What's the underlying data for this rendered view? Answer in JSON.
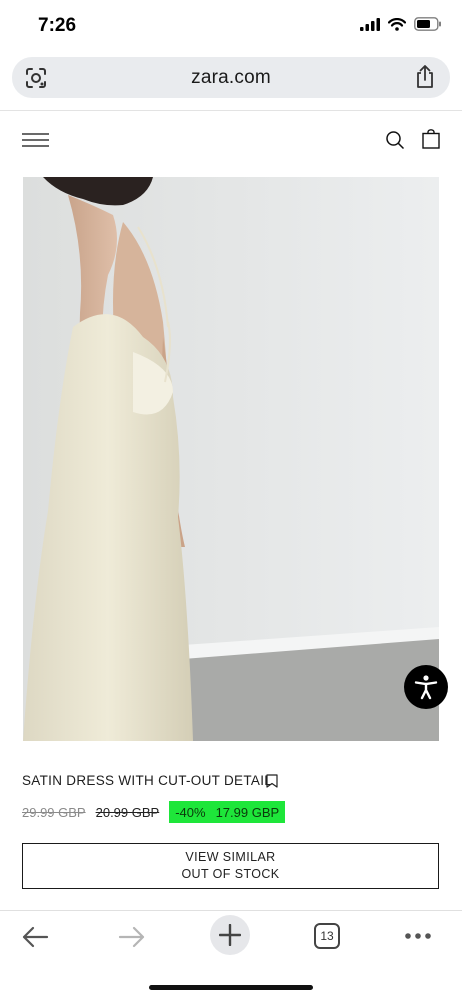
{
  "status_bar": {
    "time": "7:26"
  },
  "browser": {
    "url": "zara.com",
    "tabs_count": "13"
  },
  "product": {
    "title": "SATIN DRESS WITH CUT-OUT DETAIL",
    "price_original": "29.99 GBP",
    "price_previous": "20.99 GBP",
    "discount": "-40%",
    "price_current": "17.99 GBP"
  },
  "action_button": {
    "line1": "VIEW SIMILAR",
    "line2": "OUT OF STOCK"
  },
  "colors": {
    "discount_badge": "#1ee63a",
    "accent": "#000000"
  },
  "icons": [
    "lens-icon",
    "share-icon",
    "menu-icon",
    "search-icon",
    "bag-icon",
    "accessibility-icon",
    "bookmark-icon",
    "back-icon",
    "forward-icon",
    "plus-icon",
    "tabs-icon",
    "more-icon"
  ]
}
